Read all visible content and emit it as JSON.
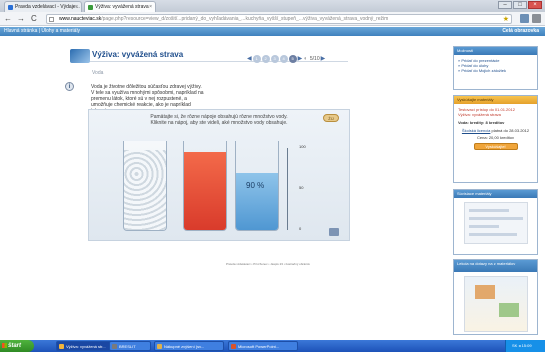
{
  "browser": {
    "tabs": [
      {
        "label": "Pravda vzdelávací - Výdaje...",
        "color": "#2a6fd6"
      },
      {
        "label": "Výživa: vyvážená strava",
        "color": "#3b9b3b"
      }
    ],
    "url_host": "www.naucteviac.sk",
    "url_path": "/page.php?resource=view_d/zošit/...pridaný_do_vyhľadávania_...kuchyňa_vyšší_stupeň_...výživa_vyvážená_strava_vodný_režim",
    "nav": {
      "back": "←",
      "forward": "→",
      "reload": "C"
    }
  },
  "site_bar": {
    "breadcrumb": "Hlavná stránka | Úlohy a materiály",
    "right_label": "Celá obrazovka"
  },
  "lesson": {
    "title": "Výživa: vyvážená strava",
    "subtitle": "Voda",
    "pages": [
      "1",
      "2",
      "3",
      "4",
      "5"
    ],
    "active_page": "5",
    "count": "5/10",
    "intro": "Voda je životne dôležitou súčasťou zdravej výživy. V tele sa využíva mnohými spôsobmi, napríklad na premenu látok, ktoré sú v nej rozpustené, a umožňuje chemické reakcie, ako je napríklad trávenie.",
    "stage_text": "Pamätajte si, že rôzne nápoje obsahujú rôzne množstvo vody. Kliknite na nápoj, aby ste videli, aké množstvo vody obsahuje.",
    "stage_button": "ŽIJ",
    "percent": "90 %",
    "scale": [
      "100",
      "50",
      "0"
    ],
    "footer": "Pravda vzdelávací • Prívrženec • Jaspis 23 • ilustračný obrázok"
  },
  "sidebar": {
    "box1_title": "Možnosti",
    "box1_items": [
      "» Pridať do prezentácie",
      "» Pridať do úlohy",
      "» Pridať do Mojich záložiek"
    ],
    "box2_title": "Vyskúšajte materiály",
    "box2_lines": [
      "Testovací prístup do 01.01.2012",
      "Výživa: vyvážená strava"
    ],
    "box2_bold": "Voda: kredity: 8 kreditov",
    "box2_link": "Školská licencia",
    "box2_until": "platná do 28.03.2012",
    "box2_price": "Cena: 20,00 kreditov",
    "box2_button": "Vyskúšajte!",
    "box3_title": "Súvisiace materiály",
    "box4_title": "Lekcia na dotazy na z materiálov"
  },
  "taskbar": {
    "start": "štart",
    "tasks": [
      {
        "label": "Výživa: vyvážená str...",
        "color": "#f0b43c"
      },
      {
        "label": "BRESLIT",
        "color": "#7a7a7a"
      },
      {
        "label": "Nákupné zvýšení (sv...",
        "color": "#e0b14a"
      },
      {
        "label": "Microsoft PowerPoint...",
        "color": "#d9532b"
      }
    ],
    "tray_text": "SK ◂ 15:09"
  },
  "colors": {
    "accent": "#3f81bd",
    "title_blue": "#1f4e8c",
    "sidebar_warn": "#e5a12c"
  }
}
